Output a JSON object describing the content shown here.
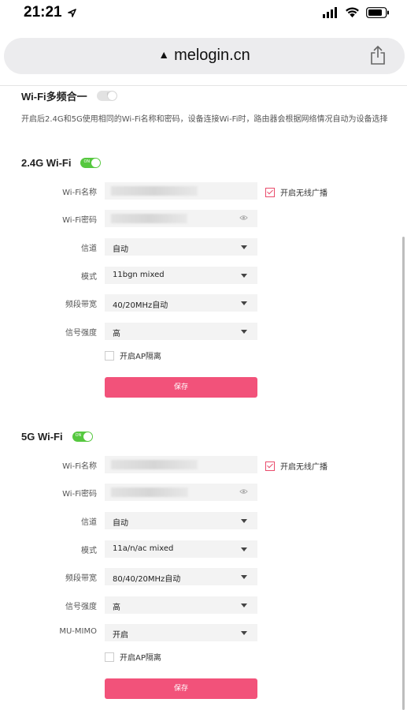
{
  "status": {
    "time": "21:21"
  },
  "browser": {
    "url": "melogin.cn",
    "warn_glyph": "▲"
  },
  "merge": {
    "title": "Wi-Fi多频合一",
    "toggle_state": "OFF",
    "desc": "开启后2.4G和5G使用相同的Wi-Fi名称和密码，设备连接Wi-Fi时，路由器会根据网络情况自动为设备选择"
  },
  "wifi24": {
    "title": "2.4G Wi-Fi",
    "toggle_state": "ON",
    "ssid_label": "Wi-Fi名称",
    "broadcast_label": "开启无线广播",
    "password_label": "Wi-Fi密码",
    "channel_label": "信道",
    "channel_value": "自动",
    "mode_label": "模式",
    "mode_value": "11bgn mixed",
    "bandwidth_label": "频段带宽",
    "bandwidth_value": "40/20MHz自动",
    "signal_label": "信号强度",
    "signal_value": "高",
    "ap_isolation_label": "开启AP隔离",
    "save_label": "保存"
  },
  "wifi5": {
    "title": "5G Wi-Fi",
    "toggle_state": "ON",
    "ssid_label": "Wi-Fi名称",
    "broadcast_label": "开启无线广播",
    "password_label": "Wi-Fi密码",
    "channel_label": "信道",
    "channel_value": "自动",
    "mode_label": "模式",
    "mode_value": "11a/n/ac mixed",
    "bandwidth_label": "频段带宽",
    "bandwidth_value": "80/40/20MHz自动",
    "signal_label": "信号强度",
    "signal_value": "高",
    "mumimo_label": "MU-MIMO",
    "mumimo_value": "开启",
    "ap_isolation_label": "开启AP隔离",
    "save_label": "保存"
  },
  "colors": {
    "accent": "#f2527a",
    "toggle_on": "#56c83f",
    "check": "#e94b6b"
  }
}
